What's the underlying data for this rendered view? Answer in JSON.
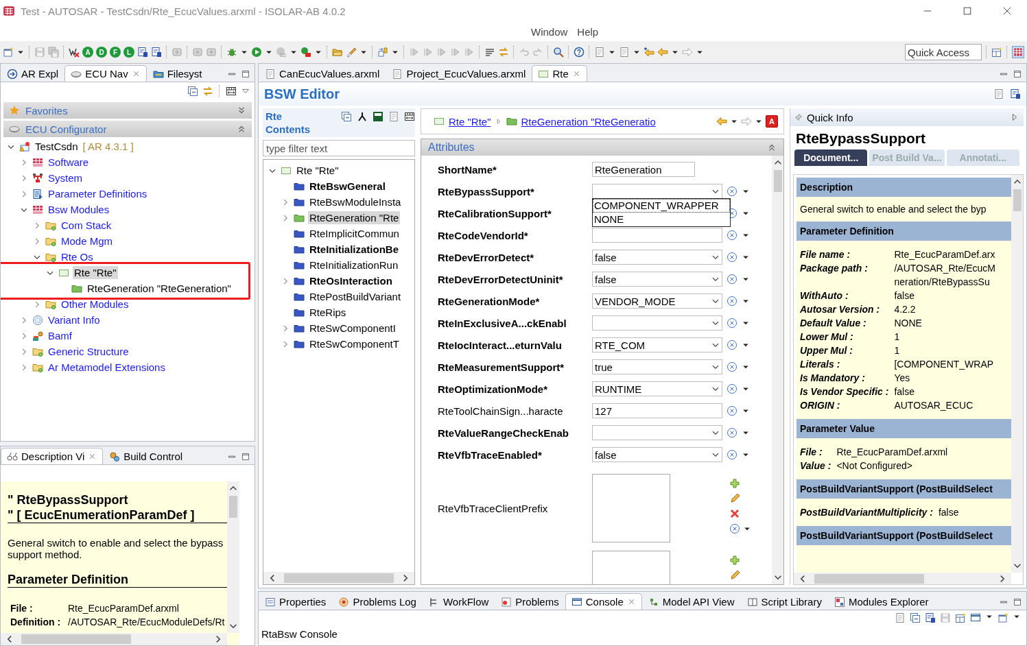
{
  "window": {
    "title": "Test - AUTOSAR - TestCsdn/Rte_EcucValues.arxml - ISOLAR-AB 4.0.2"
  },
  "menu": [
    "Window",
    "Help"
  ],
  "toolbar": {
    "badges": [
      "A",
      "D",
      "F",
      "L"
    ],
    "quick_access": {
      "placeholder": "Quick Access"
    }
  },
  "navigator": {
    "tabs": [
      {
        "label": "AR Expl",
        "selected": false,
        "closable": false
      },
      {
        "label": "ECU Nav",
        "selected": true,
        "closable": true
      },
      {
        "label": "Filesyst",
        "selected": false,
        "closable": false
      }
    ],
    "sections": [
      {
        "label": "Favorites",
        "expanded": false
      },
      {
        "label": "ECU Configurator",
        "expanded": true
      }
    ],
    "tree": [
      {
        "label": "TestCsdn",
        "suffix": "[ AR 4.3.1 ]",
        "kind": "project",
        "expanded": true,
        "selected": false,
        "children": [
          {
            "label": "Software",
            "kind": "software",
            "expanded": false,
            "selected": false
          },
          {
            "label": "System",
            "kind": "system",
            "expanded": false,
            "selected": false
          },
          {
            "label": "Parameter Definitions",
            "kind": "paramdefs",
            "expanded": false,
            "selected": false
          },
          {
            "label": "Bsw Modules",
            "kind": "software",
            "expanded": true,
            "selected": false,
            "children": [
              {
                "label": "Com Stack",
                "kind": "folder",
                "expanded": false,
                "selected": false
              },
              {
                "label": "Mode Mgm",
                "kind": "folder",
                "expanded": false,
                "selected": false
              },
              {
                "label": "Rte Os",
                "kind": "folder",
                "expanded": true,
                "selected": false,
                "children": [
                  {
                    "label": "Rte \"Rte\"",
                    "kind": "module",
                    "expanded": true,
                    "selected": true,
                    "highlighted": true,
                    "children": [
                      {
                        "label": "RteGeneration \"RteGeneration\"",
                        "kind": "container",
                        "selected": false
                      }
                    ]
                  }
                ]
              },
              {
                "label": "Other Modules",
                "kind": "folder",
                "expanded": false,
                "selected": false
              }
            ]
          },
          {
            "label": "Variant Info",
            "kind": "variant",
            "expanded": false,
            "selected": false
          },
          {
            "label": "Bamf",
            "kind": "bamf",
            "expanded": false,
            "selected": false
          },
          {
            "label": "Generic Structure",
            "kind": "folder",
            "expanded": false,
            "selected": false
          },
          {
            "label": "Ar Metamodel Extensions",
            "kind": "folder",
            "expanded": false,
            "selected": false
          }
        ]
      }
    ]
  },
  "description_view": {
    "tabs": [
      {
        "label": "Description Vi",
        "selected": true,
        "closable": true
      },
      {
        "label": "Build Control",
        "selected": false,
        "closable": false
      }
    ],
    "title_lines": [
      "\" RteBypassSupport",
      "\" [ EcucEnumerationParamDef ]"
    ],
    "text": "General switch to enable and select the bypass support method.",
    "heading": "Parameter Definition",
    "rows": [
      {
        "key": "File :",
        "value": "Rte_EcucParamDef.arxml"
      },
      {
        "key": "Definition :",
        "value": "/AUTOSAR_Rte/EcucModuleDefs/Rt"
      }
    ]
  },
  "editor_tabs": [
    {
      "label": "CanEcucValues.arxml",
      "selected": false,
      "closable": false
    },
    {
      "label": "Project_EcucValues.arxml",
      "selected": false,
      "closable": false
    },
    {
      "label": "Rte",
      "selected": true,
      "closable": true
    }
  ],
  "editor": {
    "title": "BSW Editor",
    "contents": {
      "title": "Rte Contents",
      "filter": {
        "placeholder": "type filter text"
      },
      "tree": [
        {
          "label": "Rte \"Rte\"",
          "kind": "module",
          "expanded": true,
          "selected": false,
          "bold": false,
          "children": [
            {
              "label": "RteBswGeneral",
              "kind": "folderblue",
              "selected": false,
              "bold": true
            },
            {
              "label": "RteBswModuleInsta",
              "kind": "folderblue",
              "expanded": false,
              "selected": false,
              "bold": false
            },
            {
              "label": "RteGeneration \"Rte",
              "kind": "container",
              "expanded": false,
              "selected": true,
              "bold": false
            },
            {
              "label": "RteImplicitCommun",
              "kind": "folderblue",
              "selected": false,
              "bold": false
            },
            {
              "label": "RteInitializationBe",
              "kind": "folderblue",
              "selected": false,
              "bold": true
            },
            {
              "label": "RteInitializationRun",
              "kind": "folderblue",
              "selected": false,
              "bold": false
            },
            {
              "label": "RteOsInteraction",
              "kind": "folderblue",
              "expanded": false,
              "selected": false,
              "bold": true
            },
            {
              "label": "RtePostBuildVariant",
              "kind": "folderblue",
              "selected": false,
              "bold": false
            },
            {
              "label": "RteRips",
              "kind": "folderblue",
              "selected": false,
              "bold": false
            },
            {
              "label": "RteSwComponentI",
              "kind": "folderblue",
              "expanded": false,
              "selected": false,
              "bold": false
            },
            {
              "label": "RteSwComponentT",
              "kind": "folderblue",
              "expanded": false,
              "selected": false,
              "bold": false
            }
          ]
        }
      ]
    },
    "breadcrumb": [
      {
        "label": "Rte \"Rte\"",
        "kind": "module"
      },
      {
        "label": "RteGeneration \"RteGeneratio",
        "kind": "container"
      }
    ],
    "breadcrumb_badge": "A",
    "attributes": {
      "title": "Attributes",
      "expanded": true,
      "fields": [
        {
          "label": "ShortName*",
          "bold": true,
          "kind": "text",
          "value": "RteGeneration",
          "reset": false
        },
        {
          "label": "RteBypassSupport*",
          "bold": true,
          "kind": "combo",
          "reset": true,
          "open": true,
          "options": [
            {
              "label": "COMPONENT_WRAPPER",
              "selected": true
            },
            {
              "label": "NONE",
              "selected": false
            }
          ]
        },
        {
          "label": "RteCalibrationSupport*",
          "bold": true,
          "reset": true
        },
        {
          "label": "RteCodeVendorId*",
          "bold": true,
          "kind": "text",
          "reset": true
        },
        {
          "label": "RteDevErrorDetect*",
          "bold": true,
          "kind": "combo",
          "value": "false",
          "reset": true
        },
        {
          "label": "RteDevErrorDetectUninit*",
          "bold": true,
          "kind": "combo",
          "value": "false",
          "reset": true
        },
        {
          "label": "RteGenerationMode*",
          "bold": true,
          "kind": "combo",
          "value": "VENDOR_MODE",
          "reset": true
        },
        {
          "label": "RteInExclusiveA...ckEnabl",
          "bold": true,
          "kind": "combo",
          "reset": true
        },
        {
          "label": "RteIocInteract...eturnValu",
          "bold": true,
          "kind": "combo",
          "value": "RTE_COM",
          "reset": true
        },
        {
          "label": "RteMeasurementSupport*",
          "bold": true,
          "kind": "combo",
          "value": "true",
          "reset": true
        },
        {
          "label": "RteOptimizationMode*",
          "bold": true,
          "kind": "combo",
          "value": "RUNTIME",
          "reset": true
        },
        {
          "label": "RteToolChainSign...haracte",
          "bold": false,
          "kind": "text",
          "value": "127",
          "reset": true
        },
        {
          "label": "RteValueRangeCheckEnab",
          "bold": true,
          "kind": "combo",
          "reset": true
        },
        {
          "label": "RteVfbTraceEnabled*",
          "bold": true,
          "kind": "combo",
          "value": "false",
          "reset": true
        },
        {
          "label": "RteVfbTraceClientPrefix",
          "bold": false,
          "kind": "list",
          "reset": true
        },
        {
          "kind": "list",
          "reset": false
        }
      ]
    }
  },
  "quick_info": {
    "title": "Quick Info",
    "name": "RteBypassSupport",
    "tabs": [
      {
        "label": "Document...",
        "selected": true
      },
      {
        "label": "Post Build Va...",
        "selected": false
      },
      {
        "label": "Annotati...",
        "selected": false
      }
    ],
    "sections": [
      {
        "title": "Description",
        "text": "General switch to enable and select the byp"
      },
      {
        "title": "Parameter Definition",
        "rows": [
          {
            "key": "File name :",
            "value_lines": [
              "Rte_EcucParamDef.arx"
            ]
          },
          {
            "key": "Package path :",
            "value_lines": [
              "/AUTOSAR_Rte/EcucM",
              "neration/RteBypassSu"
            ]
          },
          {
            "key": "WithAuto :",
            "value_lines": [
              "false"
            ]
          },
          {
            "key": "Autosar Version :",
            "value_lines": [
              "4.2.2"
            ]
          },
          {
            "key": "Default Value :",
            "value_lines": [
              "NONE"
            ]
          },
          {
            "key": "Lower Mul :",
            "value_lines": [
              "1"
            ]
          },
          {
            "key": "Upper Mul :",
            "value_lines": [
              "1"
            ]
          },
          {
            "key": "Literals :",
            "value_lines": [
              "[COMPONENT_WRAP"
            ]
          },
          {
            "key": "Is Mandatory :",
            "value_lines": [
              "Yes"
            ]
          },
          {
            "key": "Is Vendor Specific :",
            "value_lines": [
              "false"
            ]
          },
          {
            "key": "ORIGIN :",
            "value_lines": [
              "AUTOSAR_ECUC"
            ]
          }
        ]
      },
      {
        "title": "Parameter Value",
        "rows": [
          {
            "key": "File :",
            "value_lines": [
              "Rte_EcucParamDef.arxml"
            ]
          },
          {
            "key": "Value :",
            "value_lines": [
              "<Not Configured>"
            ]
          }
        ]
      },
      {
        "title": "PostBuildVariantSupport (PostBuildSelect",
        "rows": [
          {
            "key": "PostBuildVariantMultiplicity :",
            "value_lines": [
              "false"
            ]
          }
        ]
      },
      {
        "title": "PostBuildVariantSupport (PostBuildSelect"
      }
    ]
  },
  "bottom_panel": {
    "tabs": [
      {
        "label": "Properties",
        "selected": false,
        "closable": false
      },
      {
        "label": "Problems Log",
        "selected": false,
        "closable": false
      },
      {
        "label": "WorkFlow",
        "selected": false,
        "closable": false
      },
      {
        "label": "Problems",
        "selected": false,
        "closable": false
      },
      {
        "label": "Console",
        "selected": true,
        "closable": true
      },
      {
        "label": "Model API View",
        "selected": false,
        "closable": false
      },
      {
        "label": "Script Library",
        "selected": false,
        "closable": false
      },
      {
        "label": "Modules Explorer",
        "selected": false,
        "closable": false
      }
    ],
    "console_title": "RtaBsw Console"
  }
}
